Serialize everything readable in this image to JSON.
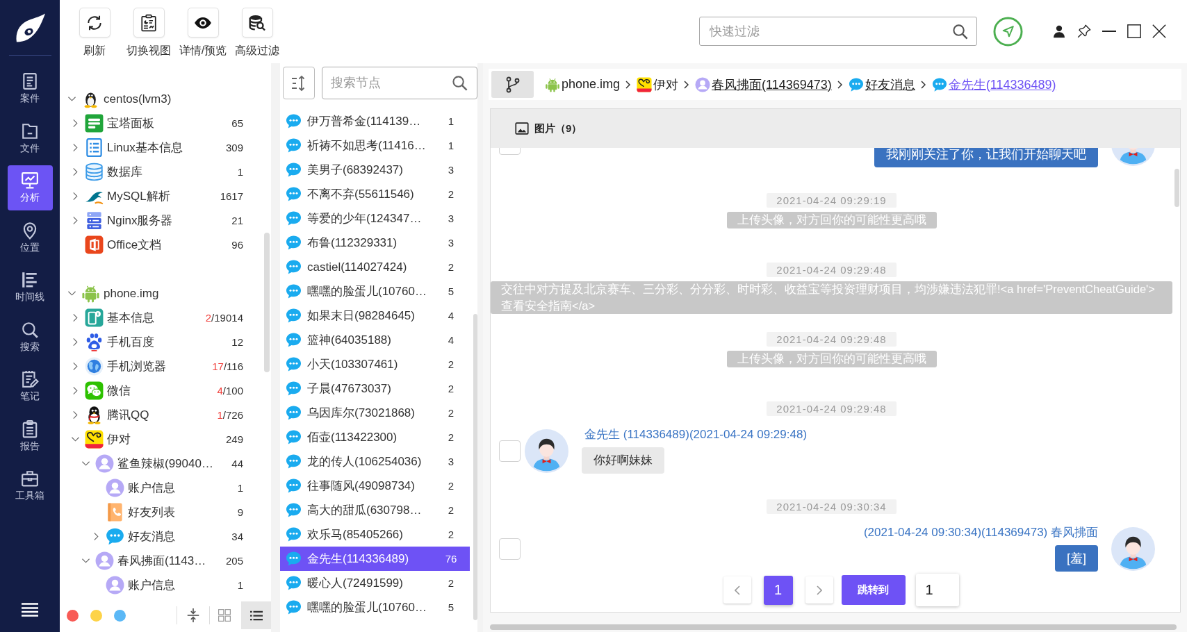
{
  "nav": {
    "items": [
      {
        "kind": "case",
        "label": "案件",
        "selected": false
      },
      {
        "kind": "file",
        "label": "文件",
        "selected": false
      },
      {
        "kind": "analysis",
        "label": "分析",
        "selected": true
      },
      {
        "kind": "location",
        "label": "位置",
        "selected": false
      },
      {
        "kind": "timeline",
        "label": "时间线",
        "selected": false
      },
      {
        "kind": "search",
        "label": "搜索",
        "selected": false
      },
      {
        "kind": "notes",
        "label": "笔记",
        "selected": false
      },
      {
        "kind": "report",
        "label": "报告",
        "selected": false
      },
      {
        "kind": "toolbox",
        "label": "工具箱",
        "selected": false
      }
    ]
  },
  "toolbar": {
    "buttons": [
      {
        "kind": "refresh",
        "label": "刷新"
      },
      {
        "kind": "switch",
        "label": "切换视图"
      },
      {
        "kind": "preview",
        "label": "详情/预览"
      },
      {
        "kind": "filter",
        "label": "高级过滤"
      }
    ]
  },
  "quick_filter": {
    "placeholder": "快速过滤"
  },
  "tree": {
    "nodes": [
      {
        "kind": "linux",
        "label": "centos(lvm3)",
        "expanded": true,
        "children": [
          {
            "kind": "panel",
            "label": "宝塔面板",
            "count": [
              {
                "text": "65",
                "alert": false
              }
            ],
            "expanded": false
          },
          {
            "kind": "info",
            "label": "Linux基本信息",
            "count": [
              {
                "text": "309",
                "alert": false
              }
            ],
            "expanded": false
          },
          {
            "kind": "database",
            "label": "数据库",
            "count": [
              {
                "text": "1",
                "alert": false
              }
            ],
            "expanded": false
          },
          {
            "kind": "mysql",
            "label": "MySQL解析",
            "count": [
              {
                "text": "1617",
                "alert": false
              }
            ],
            "expanded": false
          },
          {
            "kind": "server",
            "label": "Nginx服务器",
            "count": [
              {
                "text": "21",
                "alert": false
              }
            ],
            "expanded": false
          },
          {
            "kind": "office",
            "label": "Office文档",
            "count": [
              {
                "text": "96",
                "alert": false
              }
            ]
          }
        ]
      },
      {
        "kind": "android",
        "label": "phone.img",
        "expanded": true,
        "children": [
          {
            "kind": "device",
            "label": "基本信息",
            "count": [
              {
                "text": "2",
                "alert": true
              },
              {
                "text": "/19014",
                "alert": false
              }
            ],
            "expanded": false
          },
          {
            "kind": "baidu",
            "label": "手机百度",
            "count": [
              {
                "text": "12",
                "alert": false
              }
            ],
            "expanded": false
          },
          {
            "kind": "browser",
            "label": "手机浏览器",
            "count": [
              {
                "text": "17",
                "alert": true
              },
              {
                "text": "/116",
                "alert": false
              }
            ],
            "expanded": false
          },
          {
            "kind": "wechat",
            "label": "微信",
            "count": [
              {
                "text": "4",
                "alert": true
              },
              {
                "text": "/100",
                "alert": false
              }
            ],
            "expanded": false
          },
          {
            "kind": "qq",
            "label": "腾讯QQ",
            "count": [
              {
                "text": "1",
                "alert": true
              },
              {
                "text": "/726",
                "alert": false
              }
            ],
            "expanded": false
          },
          {
            "kind": "yidui",
            "label": "伊对",
            "count": [
              {
                "text": "249",
                "alert": false
              }
            ],
            "expanded": true,
            "children": [
              {
                "kind": "account",
                "label": "鲨鱼辣椒(99040…",
                "count": [
                  {
                    "text": "44",
                    "alert": false
                  }
                ],
                "expanded": true,
                "children": [
                  {
                    "kind": "account",
                    "label": "账户信息",
                    "count": [
                      {
                        "text": "1",
                        "alert": false
                      }
                    ]
                  },
                  {
                    "kind": "contacts",
                    "label": "好友列表",
                    "count": [
                      {
                        "text": "9",
                        "alert": false
                      }
                    ]
                  },
                  {
                    "kind": "messages",
                    "label": "好友消息",
                    "count": [
                      {
                        "text": "34",
                        "alert": false
                      }
                    ],
                    "expanded": false
                  }
                ]
              },
              {
                "kind": "account",
                "label": "春风拂面(1143…",
                "count": [
                  {
                    "text": "205",
                    "alert": false
                  }
                ],
                "expanded": true,
                "children": [
                  {
                    "kind": "account",
                    "label": "账户信息",
                    "count": [
                      {
                        "text": "1",
                        "alert": false
                      }
                    ]
                  }
                ]
              }
            ]
          }
        ]
      }
    ]
  },
  "tree_footer": {
    "color_tags": [
      {
        "color": "#f85b56"
      },
      {
        "color": "#fdd348"
      },
      {
        "color": "#5bb8f6"
      }
    ],
    "view_modes": [
      {
        "kind": "grid",
        "selected": false
      },
      {
        "kind": "list",
        "selected": true
      }
    ]
  },
  "node_list": {
    "search": {
      "placeholder": "搜索节点"
    },
    "items": [
      {
        "label": "伊万普希金(114139…",
        "count": "1",
        "selected": false
      },
      {
        "label": "祈祷不如思考(11416…",
        "count": "1",
        "selected": false
      },
      {
        "label": "美男子(68392437)",
        "count": "3",
        "selected": false
      },
      {
        "label": "不离不弃(55611546)",
        "count": "2",
        "selected": false
      },
      {
        "label": "等爱的少年(124347…",
        "count": "3",
        "selected": false
      },
      {
        "label": "布鲁(112329331)",
        "count": "3",
        "selected": false
      },
      {
        "label": "castiel(114027424)",
        "count": "2",
        "selected": false
      },
      {
        "label": "嘿嘿的脸蛋儿(10760…",
        "count": "5",
        "selected": false
      },
      {
        "label": "如果末日(98284645)",
        "count": "4",
        "selected": false
      },
      {
        "label": "篮神(64035188)",
        "count": "4",
        "selected": false
      },
      {
        "label": "小天(103307461)",
        "count": "2",
        "selected": false
      },
      {
        "label": "子晨(47673037)",
        "count": "2",
        "selected": false
      },
      {
        "label": "乌因库尔(73021868)",
        "count": "2",
        "selected": false
      },
      {
        "label": "佰壶(113422300)",
        "count": "2",
        "selected": false
      },
      {
        "label": "龙的传人(106254036)",
        "count": "3",
        "selected": false
      },
      {
        "label": "往事随风(49098734)",
        "count": "2",
        "selected": false
      },
      {
        "label": "高大的甜瓜(630798…",
        "count": "2",
        "selected": false
      },
      {
        "label": "欢乐马(85405266)",
        "count": "2",
        "selected": false
      },
      {
        "label": "金先生(114336489)",
        "count": "76",
        "selected": true
      },
      {
        "label": "暖心人(72491599)",
        "count": "2",
        "selected": false
      },
      {
        "label": "嘿嘿的脸蛋儿(10760…",
        "count": "5",
        "selected": false
      }
    ]
  },
  "breadcrumb": {
    "items": [
      {
        "kind": "android",
        "label": "phone.img",
        "link": false,
        "selected": false
      },
      {
        "kind": "yidui",
        "label": "伊对",
        "link": false,
        "selected": false
      },
      {
        "kind": "account",
        "label": "春风拂面(114369473)",
        "link": true,
        "selected": false
      },
      {
        "kind": "messages",
        "label": "好友消息",
        "link": true,
        "selected": false
      },
      {
        "kind": "messages",
        "label": "金先生(114336489)",
        "link": true,
        "selected": true
      }
    ]
  },
  "content": {
    "tab": {
      "label": "图片（9）"
    },
    "messages": [
      {
        "kind": "outgoing",
        "text": "我刚刚关注了你，让我们开始聊天吧",
        "checked": false
      },
      {
        "kind": "notice",
        "time": "2021-04-24 09:29:19",
        "text": "上传头像，对方回你的可能性更高哦"
      },
      {
        "kind": "notice",
        "time": "2021-04-24 09:29:48",
        "text": "交往中对方提及北京赛车、三分彩、分分彩、时时彩、收益宝等投资理财项目，均涉嫌违法犯罪!<a href='PreventCheatGuide'>查看安全指南</a>"
      },
      {
        "kind": "notice",
        "time": "2021-04-24 09:29:48",
        "text": "上传头像，对方回你的可能性更高哦"
      },
      {
        "kind": "incoming",
        "time": "2021-04-24 09:29:48",
        "sender": "金先生 (114336489)(2021-04-24 09:29:48)",
        "text": "你好啊妹妹",
        "checked": false
      },
      {
        "kind": "outgoing",
        "time": "2021-04-24 09:30:34",
        "sender": "(2021-04-24 09:30:34)(114369473) 春风拂面",
        "text": "[羞]",
        "checked": false
      }
    ],
    "pagination": {
      "pages": [
        {
          "label": "1",
          "selected": true
        }
      ],
      "jump_label": "跳转到",
      "page_input": "1"
    }
  }
}
